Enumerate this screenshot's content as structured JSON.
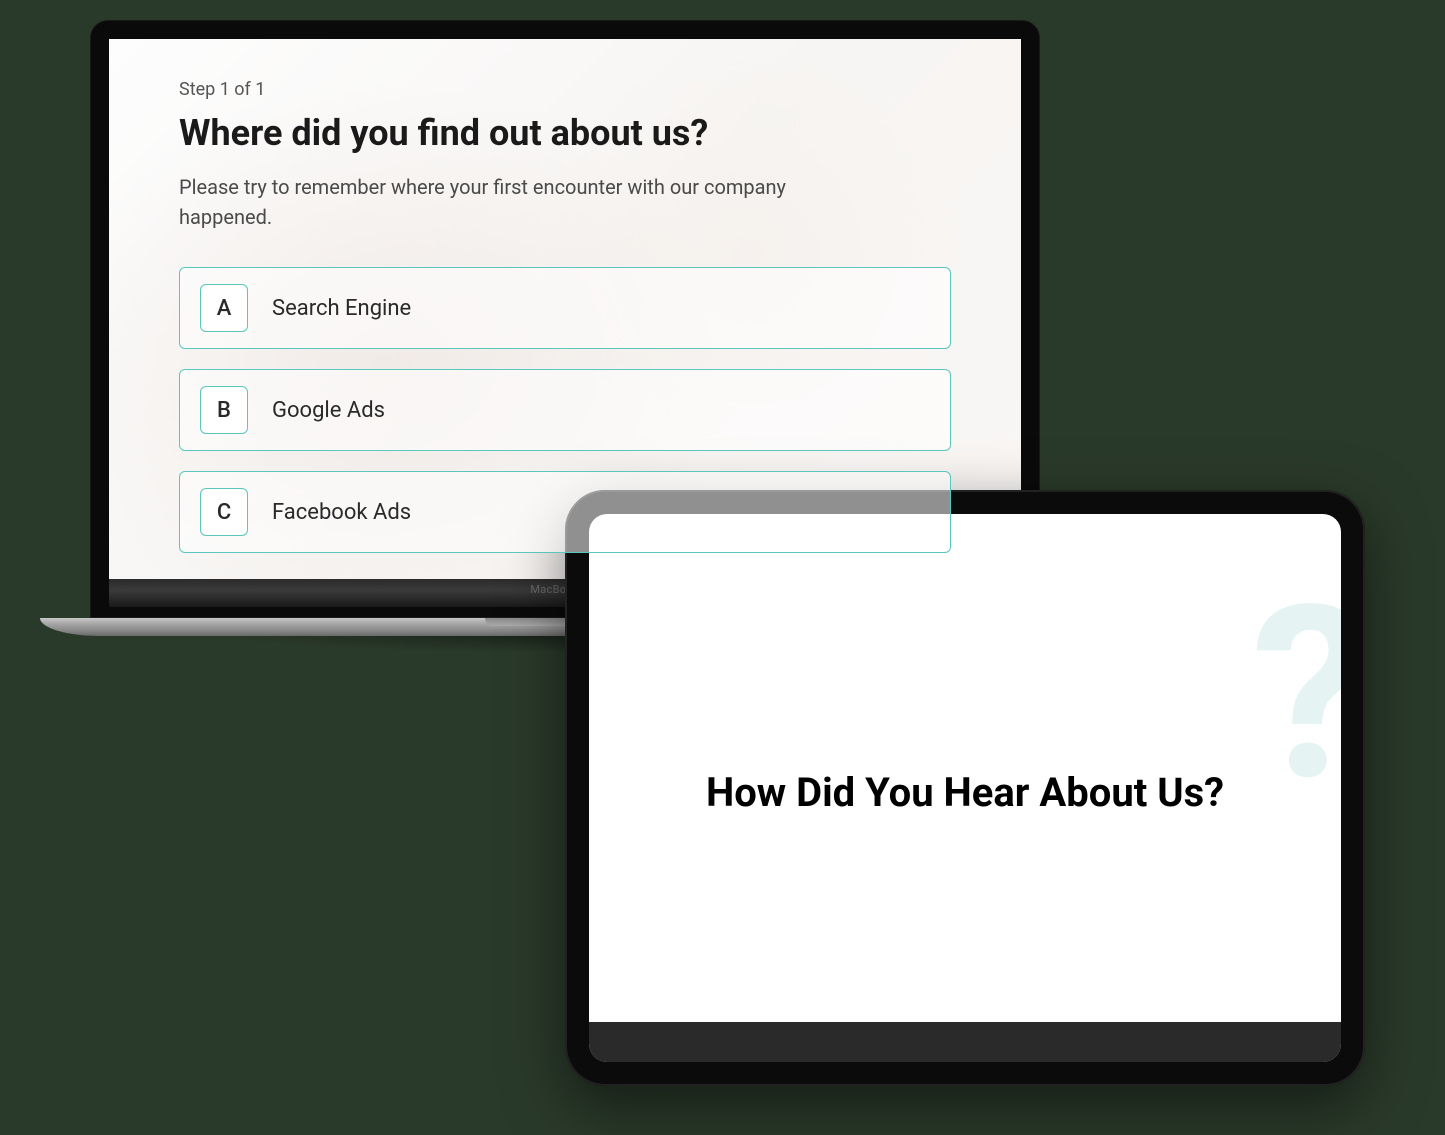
{
  "laptop": {
    "device_label": "MacBook Pro",
    "step_label": "Step 1 of 1",
    "title": "Where did you find out about us?",
    "description": "Please try to remember where your first encounter with our company happened.",
    "options": [
      {
        "key": "A",
        "label": "Search Engine"
      },
      {
        "key": "B",
        "label": "Google Ads"
      },
      {
        "key": "C",
        "label": "Facebook Ads"
      }
    ]
  },
  "tablet": {
    "title": "How Did You Hear About Us?",
    "bg_icon": "question-mark-icon"
  },
  "colors": {
    "accent": "#5ac7bd"
  }
}
